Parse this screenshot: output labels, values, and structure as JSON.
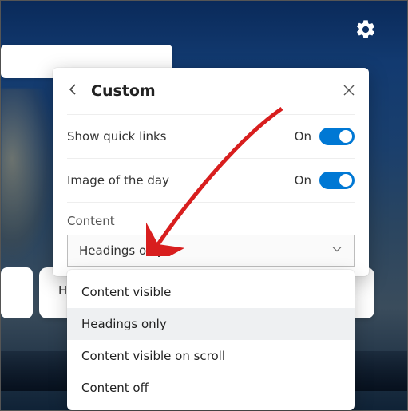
{
  "gear_icon": "settings",
  "panel": {
    "title": "Custom",
    "rows": {
      "quick_links": {
        "label": "Show quick links",
        "state": "On"
      },
      "image_of_day": {
        "label": "Image of the day",
        "state": "On"
      }
    },
    "content_label": "Content",
    "dropdown": {
      "selected": "Headings only",
      "options": [
        "Content visible",
        "Headings only",
        "Content visible on scroll",
        "Content off"
      ]
    }
  },
  "background_card_text": "Ho"
}
